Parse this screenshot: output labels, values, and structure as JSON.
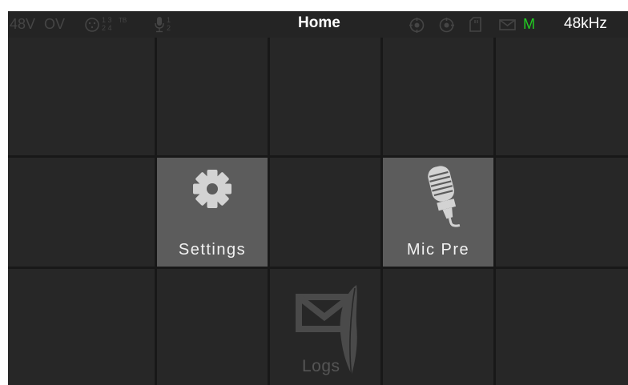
{
  "status_bar": {
    "phantom_label": "48V",
    "overvoltage_label": "OV",
    "input_numbers_top": "1 3",
    "input_numbers_bottom": "2 4",
    "talkback_label": "TB",
    "mic_numbers_top": "1",
    "mic_numbers_bottom": "2",
    "title": "Home",
    "mode_indicator": "M",
    "sample_rate": "48kHz",
    "colors": {
      "mode_indicator": "#22cc22",
      "inactive": "#454545",
      "active_text": "#ffffff"
    }
  },
  "tiles": {
    "settings": {
      "label": "Settings",
      "icon": "gear-icon"
    },
    "mic_pre": {
      "label": "Mic Pre",
      "icon": "microphone-icon"
    },
    "logs": {
      "label": "Logs",
      "icon": "envelope-feather-icon"
    }
  }
}
